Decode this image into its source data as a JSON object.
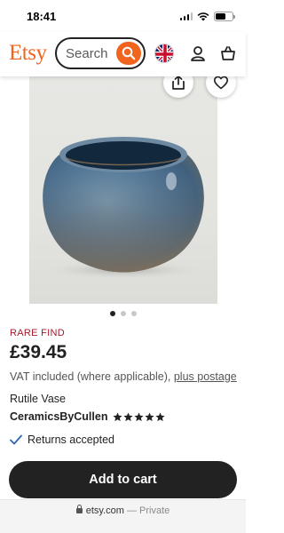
{
  "status_bar": {
    "time": "18:41"
  },
  "header": {
    "logo": "Etsy",
    "search_placeholder": "Search"
  },
  "carousel": {
    "total_images": 3,
    "active_index": 0
  },
  "listing": {
    "badge": "RARE FIND",
    "price": "£39.45",
    "vat_text": "VAT included (where applicable),",
    "vat_link": "plus postage",
    "title": "Rutile Vase",
    "shop_name": "CeramicsByCullen",
    "rating_stars": 5,
    "returns_text": "Returns accepted"
  },
  "actions": {
    "add_to_cart_label": "Add to cart"
  },
  "browser": {
    "domain": "etsy.com",
    "separator": "—",
    "mode": "Private"
  },
  "colors": {
    "brand": "#f1641e",
    "badge": "#a61a2e",
    "button": "#222222",
    "check": "#2f66b3"
  }
}
